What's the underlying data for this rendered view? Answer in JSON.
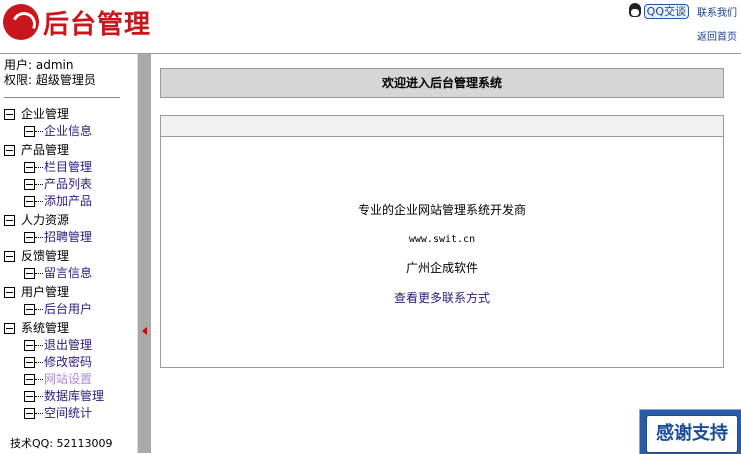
{
  "header": {
    "logo_text": "后台管理",
    "qq_button": "QQ交谈",
    "contact_link": "联系我们",
    "home_link": "返回首页"
  },
  "sidebar": {
    "user_label": "用户: admin",
    "role_label": "权限: 超级管理员",
    "sections": [
      {
        "title": "企业管理",
        "items": [
          {
            "label": "企业信息"
          }
        ]
      },
      {
        "title": "产品管理",
        "items": [
          {
            "label": "栏目管理"
          },
          {
            "label": "产品列表"
          },
          {
            "label": "添加产品"
          }
        ]
      },
      {
        "title": "人力资源",
        "items": [
          {
            "label": "招聘管理"
          }
        ]
      },
      {
        "title": "反馈管理",
        "items": [
          {
            "label": "留言信息"
          }
        ]
      },
      {
        "title": "用户管理",
        "items": [
          {
            "label": "后台用户"
          }
        ]
      },
      {
        "title": "系统管理",
        "items": [
          {
            "label": "退出管理"
          },
          {
            "label": "修改密码"
          },
          {
            "label": "网站设置"
          },
          {
            "label": "数据库管理"
          },
          {
            "label": "空间统计"
          }
        ]
      }
    ],
    "tech_qq": "技术QQ: 52113009"
  },
  "main": {
    "welcome": "欢迎进入后台管理系统",
    "line1": "专业的企业网站管理系统开发商",
    "line2": "www.swit.cn",
    "line3": "广州企成软件",
    "line4": "查看更多联系方式"
  },
  "badge": {
    "thanks": "感谢支持"
  }
}
